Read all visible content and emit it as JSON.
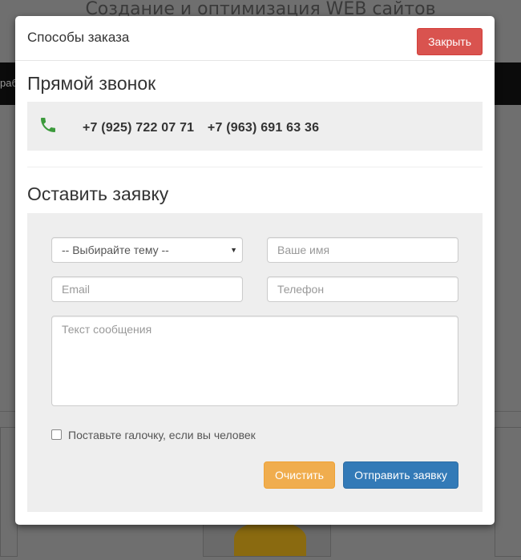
{
  "background": {
    "site_title": "Создание и оптимизация WEB сайтов",
    "nav_fragment": "раб"
  },
  "modal": {
    "title": "Способы заказа",
    "close_label": "Закрыть",
    "direct_call": {
      "heading": "Прямой звонок",
      "phones": [
        "+7 (925) 722 07 71",
        "+7 (963) 691 63 36"
      ],
      "icon": "phone-icon",
      "icon_color": "#3c9a3c"
    },
    "order_form": {
      "heading": "Оставить заявку",
      "topic_select": "-- Выбирайте тему --",
      "name_placeholder": "Ваше имя",
      "email_placeholder": "Email",
      "phone_placeholder": "Телефон",
      "message_placeholder": "Текст сообщения",
      "captcha_label": "Поставьте галочку, если вы человек",
      "clear_label": "Очистить",
      "submit_label": "Отправить заявку"
    }
  },
  "colors": {
    "close_button": "#d9534f",
    "clear_button": "#f0ad4e",
    "submit_button": "#337ab7",
    "panel_bg": "#eeeeee"
  }
}
